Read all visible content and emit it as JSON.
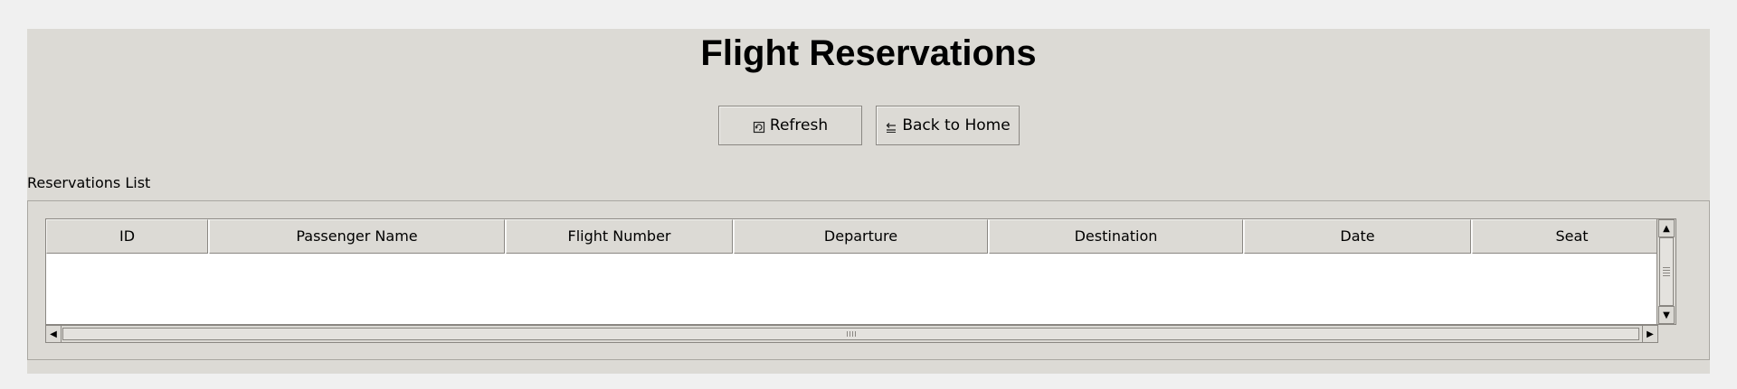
{
  "page": {
    "title": "Flight Reservations"
  },
  "toolbar": {
    "refresh_label": "Refresh",
    "back_label": "Back to Home"
  },
  "reservations": {
    "label": "Reservations List",
    "columns": [
      "ID",
      "Passenger Name",
      "Flight Number",
      "Departure",
      "Destination",
      "Date",
      "Seat"
    ],
    "rows": []
  },
  "colors": {
    "window_bg": "#dcdad5",
    "table_bg": "#ffffff",
    "border": "#8a8782"
  }
}
